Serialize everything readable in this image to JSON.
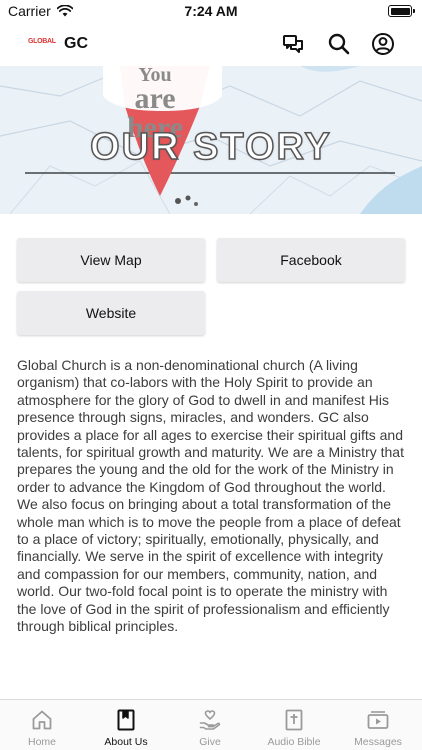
{
  "status_bar": {
    "carrier": "Carrier",
    "time": "7:24 AM"
  },
  "header": {
    "logo_text": "GLOBAL",
    "title": "GC"
  },
  "banner": {
    "pin_line1": "You",
    "pin_line2": "are",
    "pin_line3": "here",
    "title": "OUR STORY"
  },
  "buttons": {
    "view_map": "View Map",
    "facebook": "Facebook",
    "website": "Website"
  },
  "description": "Global Church is a non-denominational church (A living organism) that co-labors with the Holy Spirit to provide an atmosphere for the glory of God to dwell in and manifest His presence through signs, miracles, and wonders. GC also provides a place for all ages to exercise their spiritual gifts and talents, for spiritual growth and maturity. We are a Ministry that prepares the young and the old for the work of the Ministry in order to advance the Kingdom of God throughout the world. We also focus on bringing about a total transformation of the whole man which is to move the people from a place of defeat to a place of victory; spiritually, emotionally, physically, and financially. We serve in the spirit of excellence with integrity and compassion for our members, community, nation, and world. Our two-fold focal point is to operate the ministry with the love of God in the spirit of professionalism and efficiently through biblical principles.",
  "tabs": [
    {
      "label": "Home",
      "icon": "home-icon",
      "active": false
    },
    {
      "label": "About Us",
      "icon": "book-icon",
      "active": true
    },
    {
      "label": "Give",
      "icon": "give-icon",
      "active": false
    },
    {
      "label": "Audio Bible",
      "icon": "bible-icon",
      "active": false
    },
    {
      "label": "Messages",
      "icon": "video-icon",
      "active": false
    }
  ],
  "colors": {
    "button_bg": "#ececee",
    "active_tab": "#111111",
    "inactive_tab": "#9a9a9a",
    "pin_red": "#e4575a",
    "map_blue": "#cfe6f4"
  }
}
